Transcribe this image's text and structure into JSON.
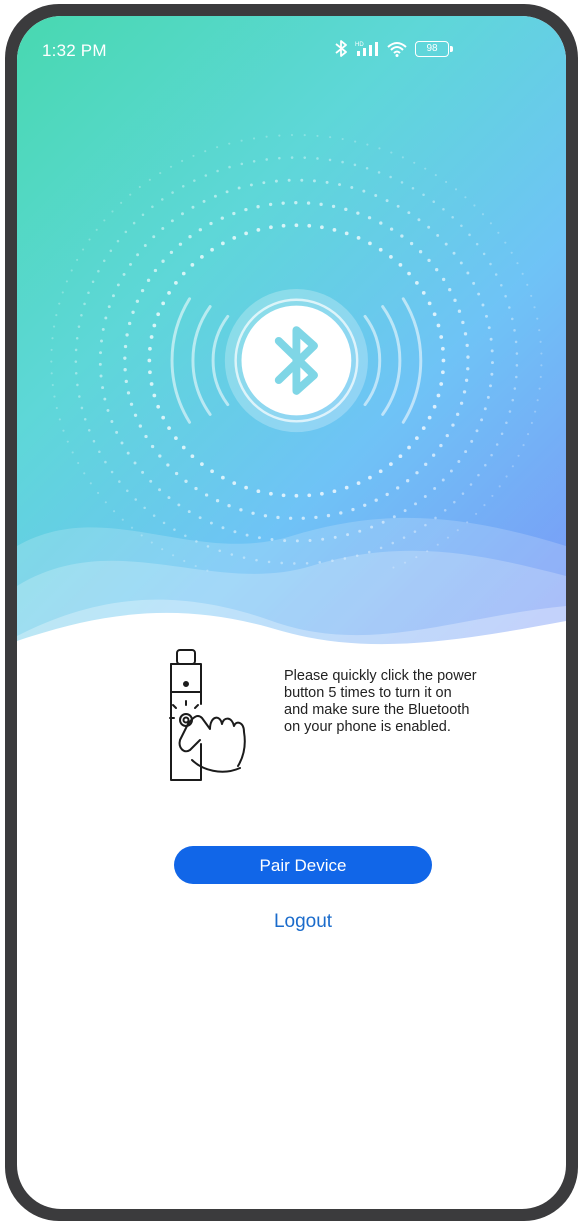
{
  "status_bar": {
    "time": "1:32 PM",
    "battery_level": "98",
    "icons": [
      "bluetooth-icon",
      "hd-signal-icon",
      "wifi-icon",
      "battery-icon"
    ]
  },
  "hero": {
    "icon": "bluetooth-icon",
    "colors": {
      "gradient_start": "#48d8b0",
      "gradient_end": "#7b96f7"
    }
  },
  "instructions": {
    "illustration": "hand-pressing-device-button",
    "text": "Please quickly click the power button 5 times to turn it on and make sure the Bluetooth on your phone is enabled."
  },
  "actions": {
    "pair_label": "Pair Device",
    "logout_label": "Logout"
  },
  "colors": {
    "accent": "#1166e8",
    "link": "#1a6bcb"
  }
}
